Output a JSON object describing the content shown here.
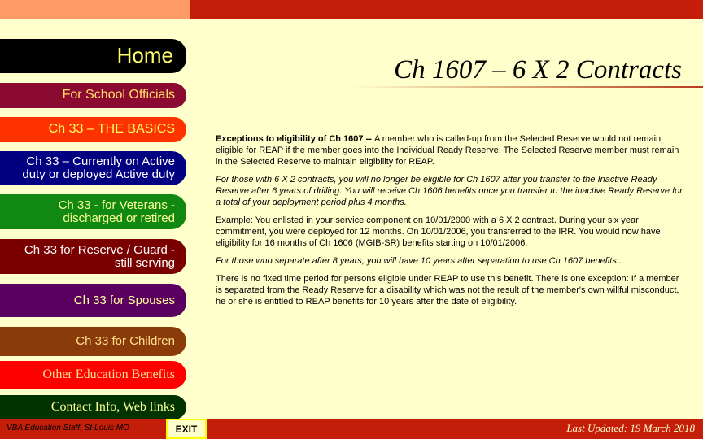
{
  "page_title": "Ch 1607 – 6 X 2 Contracts",
  "nav": {
    "home": "Home",
    "school_officials": "For School Officials",
    "basics": "Ch 33 – THE BASICS",
    "active_line1": "Ch 33 – Currently on Active",
    "active_line2": "duty or deployed Active duty",
    "veterans_line1": "Ch 33 - for Veterans -",
    "veterans_line2": "discharged or retired",
    "reserve_line1": "Ch 33 for Reserve / Guard -",
    "reserve_line2": "still serving",
    "spouses": "Ch 33 for Spouses",
    "children": "Ch 33 for Children",
    "other": "Other Education Benefits",
    "contact": "Contact Info, Web links"
  },
  "content": {
    "p1_bold": "Exceptions to eligibility of Ch 1607 -- ",
    "p1_text": "A member who is called-up from the Selected Reserve would not remain eligible for REAP if the member goes into the Individual Ready Reserve. The Selected Reserve member must remain in the Selected Reserve to maintain eligibility for REAP.",
    "p2": "For those with 6 X 2 contracts, you will no longer be eligible for Ch 1607 after you transfer to the Inactive Ready Reserve after 6 years of drilling. You will receive Ch 1606 benefits once you transfer to the inactive Ready Reserve for a total of your deployment period plus 4 months.",
    "p3": "Example: You enlisted in your service component on 10/01/2000 with a 6 X 2 contract. During your six year commitment, you were deployed for 12 months. On 10/01/2006, you transferred to the IRR. You would now have eligibility for 16 months of Ch 1606 (MGIB-SR) benefits starting on 10/01/2006.",
    "p4": "For those who separate after 8 years, you will have 10 years after separation to use Ch 1607 benefits..",
    "p5": "There is no fixed time period for persons eligible under REAP to use this benefit. There is one exception: If a member is separated from the Ready Reserve for a disability which was not the result of the member's own willful misconduct, he or she is entitled to REAP benefits for 10 years after the date of eligibility."
  },
  "footer": {
    "left": "VBA Education Staff, St Louis MO",
    "exit": "EXIT",
    "right": "Last Updated: 19 March 2018"
  },
  "colors": {
    "background": "#FFFFCC",
    "top_bar_accent": "#FF9966",
    "top_bar_main": "#C41E0A"
  }
}
